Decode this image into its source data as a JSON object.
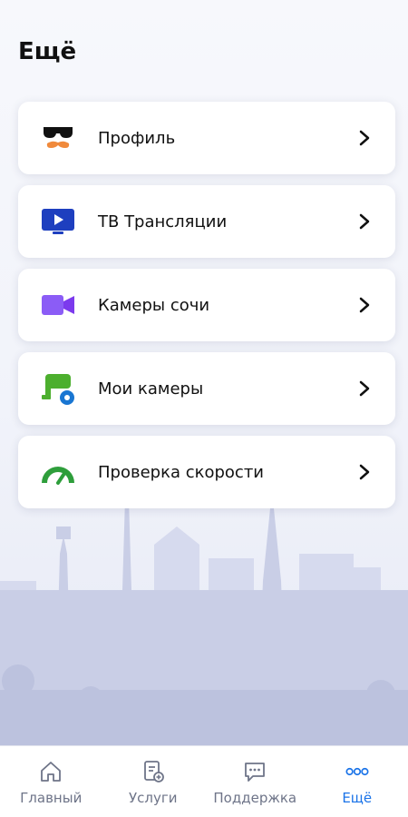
{
  "page": {
    "title": "Ещё"
  },
  "menu": {
    "items": [
      {
        "label": "Профиль",
        "icon": "profile-sunglasses-mustache-icon"
      },
      {
        "label": "ТВ Трансляции",
        "icon": "tv-play-icon"
      },
      {
        "label": "Камеры сочи",
        "icon": "video-camera-icon"
      },
      {
        "label": "Мои камеры",
        "icon": "cctv-camera-icon"
      },
      {
        "label": "Проверка скорости",
        "icon": "speedometer-icon"
      }
    ]
  },
  "tabbar": {
    "tabs": [
      {
        "label": "Главный",
        "icon": "home-icon",
        "active": false
      },
      {
        "label": "Услуги",
        "icon": "services-document-icon",
        "active": false
      },
      {
        "label": "Поддержка",
        "icon": "chat-bubble-icon",
        "active": false
      },
      {
        "label": "Ещё",
        "icon": "more-dots-icon",
        "active": true
      }
    ]
  },
  "colors": {
    "accent": "#1a73e8",
    "background": "#f1f3fa",
    "skyline": "#c9cee6"
  }
}
